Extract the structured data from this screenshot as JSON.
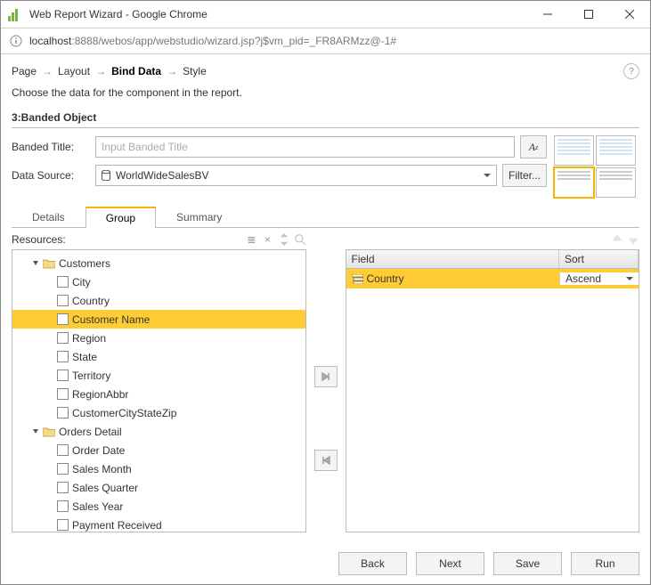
{
  "window": {
    "title": "Web Report Wizard - Google Chrome"
  },
  "url": {
    "host": "localhost",
    "rest": ":8888/webos/app/webstudio/wizard.jsp?j$vm_pid=_FR8ARMzz@-1#"
  },
  "breadcrumb": {
    "items": [
      "Page",
      "Layout",
      "Bind Data",
      "Style"
    ],
    "active_index": 2,
    "subtitle": "Choose the data for the component in the report."
  },
  "section": {
    "heading": "3:Banded Object"
  },
  "form": {
    "banded_title_label": "Banded Title:",
    "banded_title_placeholder": "Input Banded Title",
    "data_source_label": "Data Source:",
    "data_source_value": "WorldWideSalesBV",
    "font_button": "A",
    "filter_button": "Filter..."
  },
  "tabs": {
    "items": [
      "Details",
      "Group",
      "Summary"
    ],
    "active_index": 1
  },
  "resources": {
    "label": "Resources:",
    "tree": [
      {
        "type": "folder",
        "label": "Customers",
        "expanded": true,
        "children": [
          {
            "type": "field",
            "label": "City"
          },
          {
            "type": "field",
            "label": "Country"
          },
          {
            "type": "field",
            "label": "Customer Name",
            "selected": true
          },
          {
            "type": "field",
            "label": "Region"
          },
          {
            "type": "field",
            "label": "State"
          },
          {
            "type": "field",
            "label": "Territory"
          },
          {
            "type": "field",
            "label": "RegionAbbr"
          },
          {
            "type": "field",
            "label": "CustomerCityStateZip"
          }
        ]
      },
      {
        "type": "folder",
        "label": "Orders Detail",
        "expanded": true,
        "children": [
          {
            "type": "field",
            "label": "Order Date"
          },
          {
            "type": "field",
            "label": "Sales Month"
          },
          {
            "type": "field",
            "label": "Sales Quarter"
          },
          {
            "type": "field",
            "label": "Sales Year"
          },
          {
            "type": "field",
            "label": "Payment Received"
          }
        ]
      }
    ]
  },
  "grid": {
    "headers": {
      "field": "Field",
      "sort": "Sort"
    },
    "rows": [
      {
        "field": "Country",
        "sort": "Ascend"
      }
    ]
  },
  "footer": {
    "back": "Back",
    "next": "Next",
    "save": "Save",
    "run": "Run"
  }
}
